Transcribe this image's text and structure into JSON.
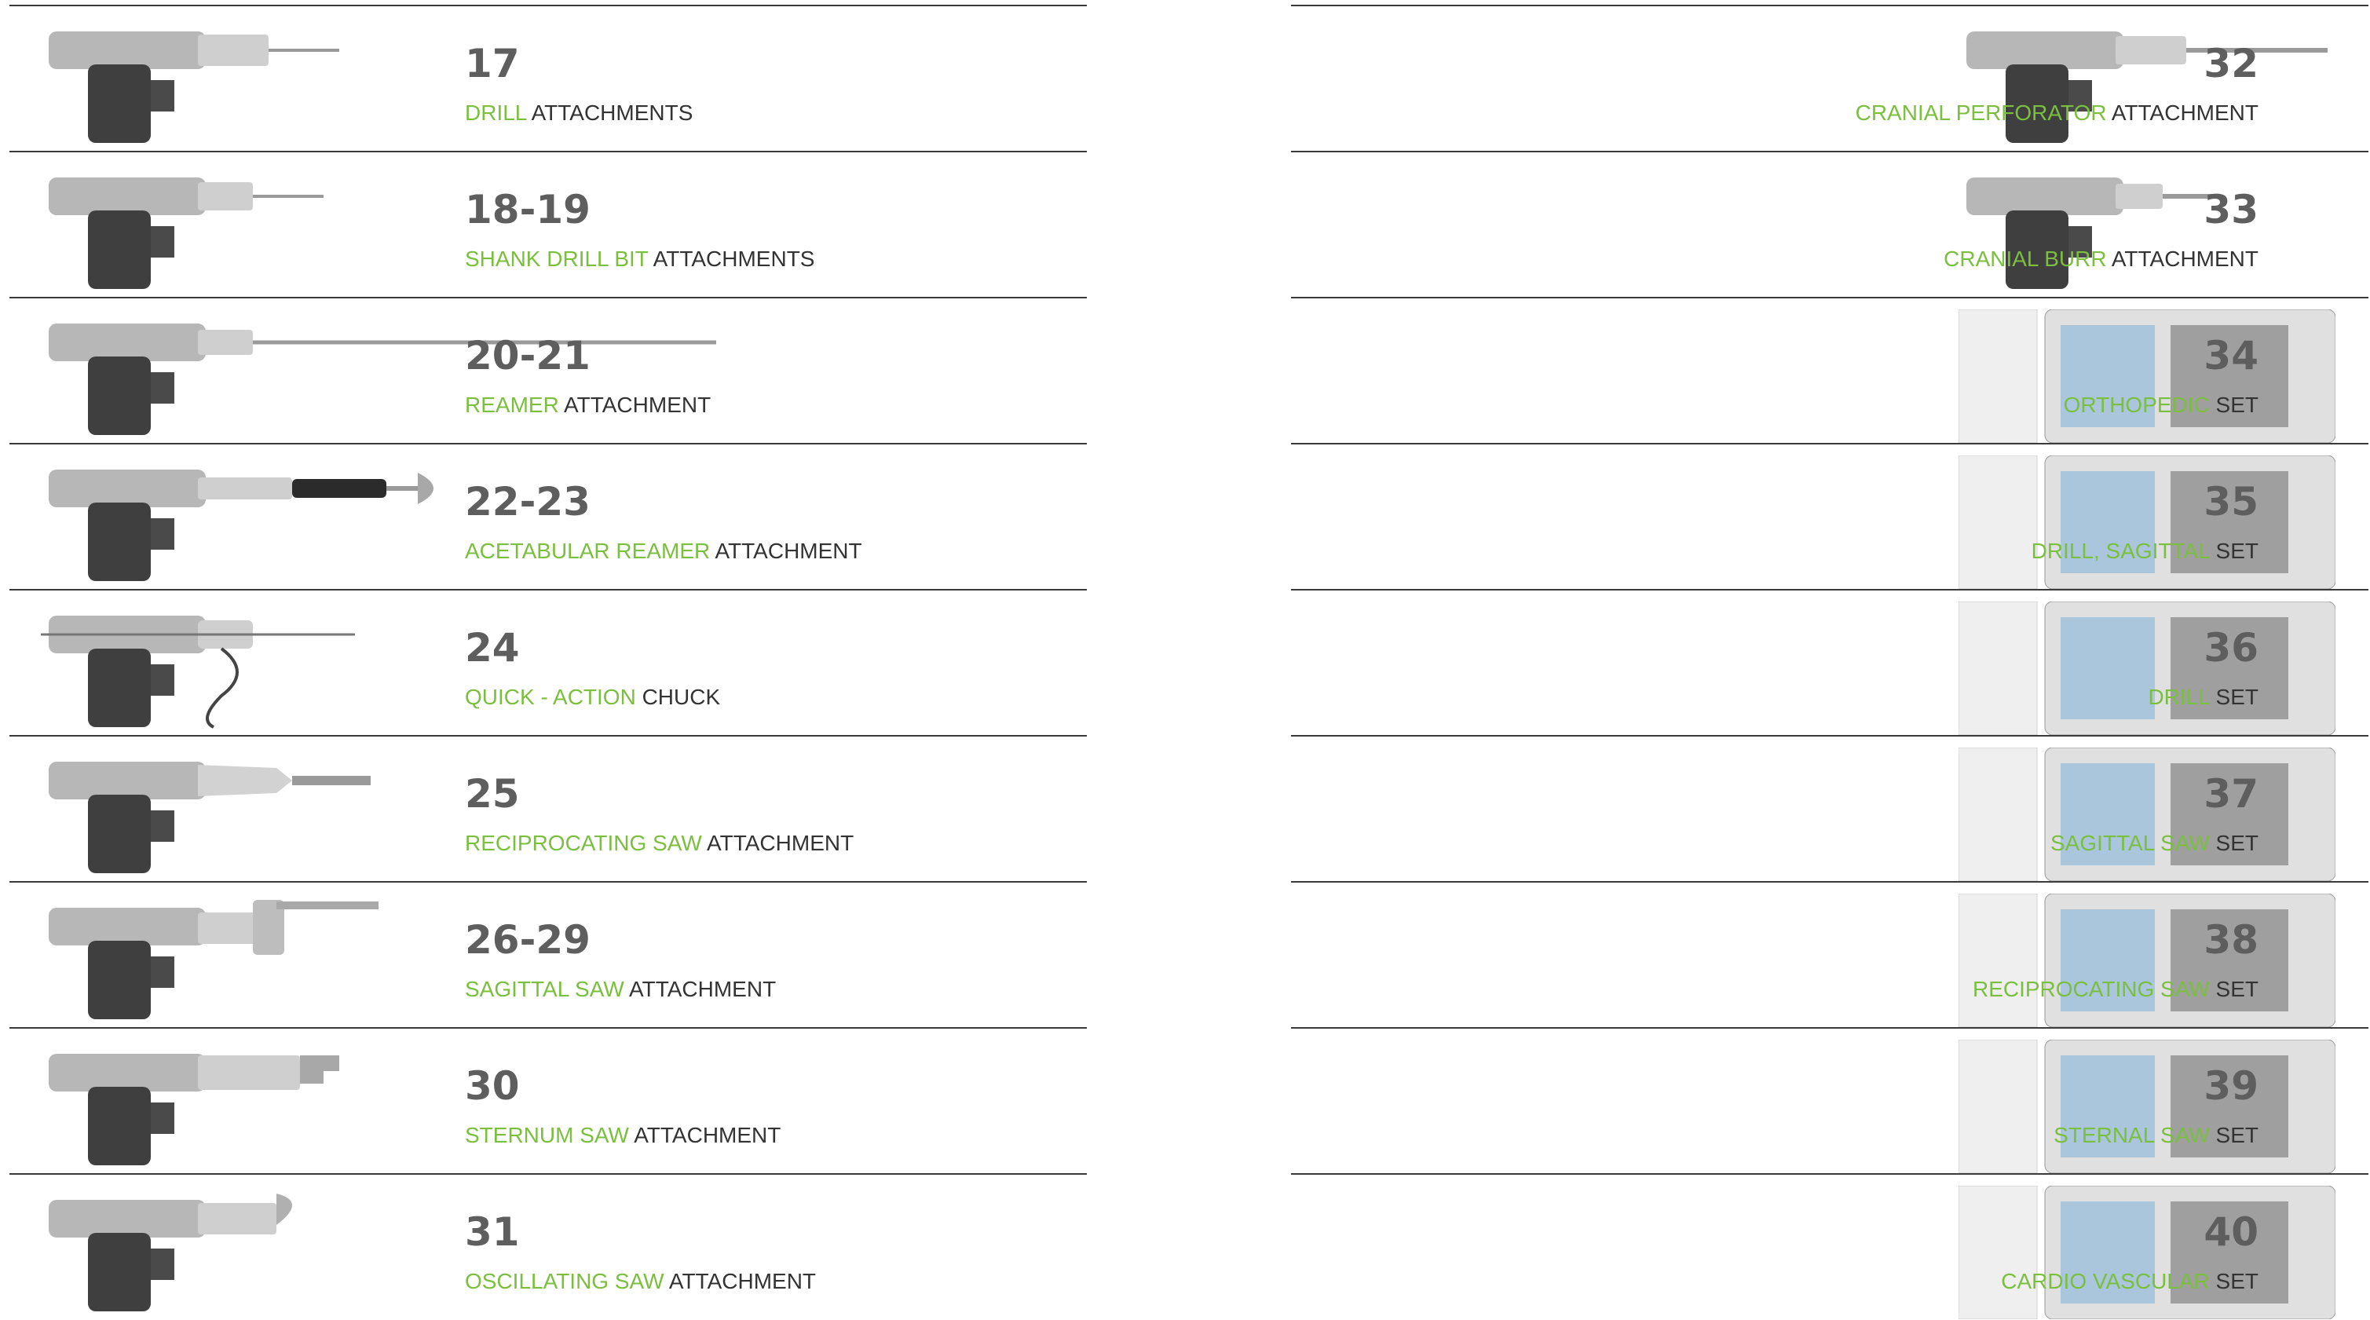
{
  "left_items": [
    {
      "number": "17",
      "accent": "DRILL",
      "rest": " ATTACHMENTS",
      "image": "drill-attachment-image"
    },
    {
      "number": "18-19",
      "accent": "SHANK DRILL BIT",
      "rest": " ATTACHMENTS",
      "image": "shank-drill-bit-image"
    },
    {
      "number": "20-21",
      "accent": "REAMER",
      "rest": " ATTACHMENT",
      "image": "reamer-attachment-image"
    },
    {
      "number": "22-23",
      "accent": "ACETABULAR REAMER",
      "rest": " ATTACHMENT",
      "image": "acetabular-reamer-image"
    },
    {
      "number": "24",
      "accent": "QUICK - ACTION",
      "rest": " CHUCK",
      "image": "quick-action-chuck-image"
    },
    {
      "number": "25",
      "accent": "RECIPROCATING SAW",
      "rest": " ATTACHMENT",
      "image": "reciprocating-saw-image"
    },
    {
      "number": "26-29",
      "accent": "SAGITTAL SAW",
      "rest": " ATTACHMENT",
      "image": "sagittal-saw-image"
    },
    {
      "number": "30",
      "accent": "STERNUM SAW",
      "rest": " ATTACHMENT",
      "image": "sternum-saw-image"
    },
    {
      "number": "31",
      "accent": "OSCILLATING SAW",
      "rest": " ATTACHMENT",
      "image": "oscillating-saw-image"
    }
  ],
  "right_items": [
    {
      "number": "32",
      "accent": "CRANIAL PERFORATOR",
      "rest": " ATTACHMENT",
      "image": "cranial-perforator-image"
    },
    {
      "number": "33",
      "accent": "CRANIAL BURR",
      "rest": " ATTACHMENT",
      "image": "cranial-burr-image"
    },
    {
      "number": "34",
      "accent": "ORTHOPEDIC",
      "rest": " SET",
      "image": "orthopedic-set-image"
    },
    {
      "number": "35",
      "accent": "DRILL, SAGITTAL",
      "rest": " SET",
      "image": "drill-sagittal-set-image"
    },
    {
      "number": "36",
      "accent": "DRILL",
      "rest": " SET",
      "image": "drill-set-image"
    },
    {
      "number": "37",
      "accent": "SAGITTAL SAW",
      "rest": " SET",
      "image": "sagittal-saw-set-image"
    },
    {
      "number": "38",
      "accent": "RECIPROCATING SAW",
      "rest": " SET",
      "image": "reciprocating-saw-set-image"
    },
    {
      "number": "39",
      "accent": "STERNAL SAW",
      "rest": " SET",
      "image": "sternal-saw-set-image"
    },
    {
      "number": "40",
      "accent": "CARDIO VASCULAR",
      "rest": " SET",
      "image": "cardio-vascular-set-image"
    }
  ],
  "colors": {
    "accent": "#7bbf3f",
    "text": "#333333",
    "number": "#5e5e5e",
    "rule": "#3a3a3a"
  }
}
